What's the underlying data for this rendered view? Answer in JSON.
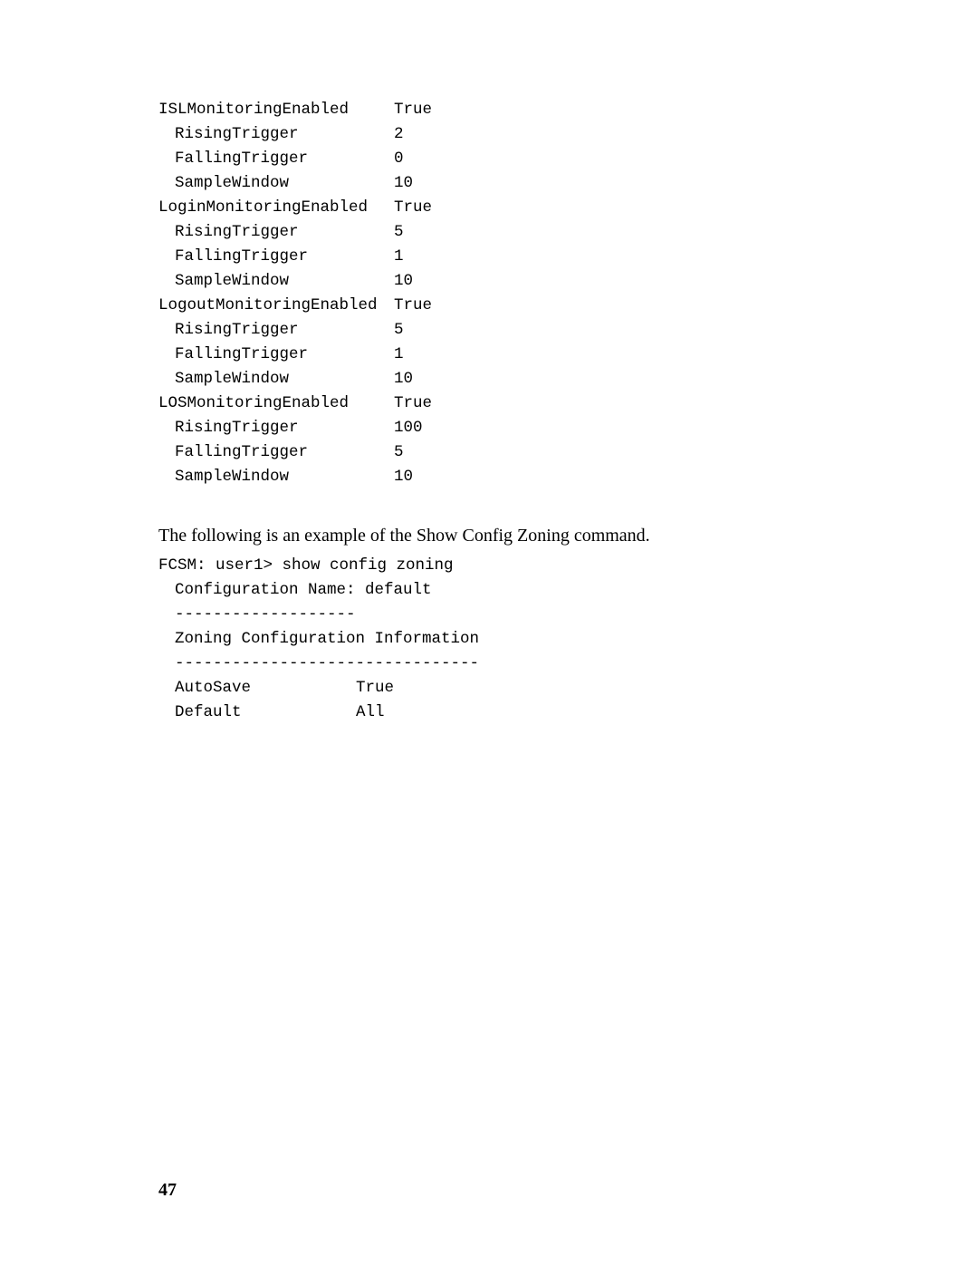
{
  "threshold_rows": [
    {
      "label": "ISLMonitoringEnabled",
      "value": "True",
      "indent": 0
    },
    {
      "label": "RisingTrigger",
      "value": "2",
      "indent": 1
    },
    {
      "label": "FallingTrigger",
      "value": "0",
      "indent": 1
    },
    {
      "label": "SampleWindow",
      "value": "10",
      "indent": 1
    },
    {
      "label": "LoginMonitoringEnabled",
      "value": "True",
      "indent": 0
    },
    {
      "label": "RisingTrigger",
      "value": "5",
      "indent": 1
    },
    {
      "label": "FallingTrigger",
      "value": "1",
      "indent": 1
    },
    {
      "label": "SampleWindow",
      "value": "10",
      "indent": 1
    },
    {
      "label": "LogoutMonitoringEnabled",
      "value": "True",
      "indent": 0
    },
    {
      "label": "RisingTrigger",
      "value": "5",
      "indent": 1
    },
    {
      "label": "FallingTrigger",
      "value": "1",
      "indent": 1
    },
    {
      "label": "SampleWindow",
      "value": "10",
      "indent": 1
    },
    {
      "label": "LOSMonitoringEnabled",
      "value": "True",
      "indent": 0
    },
    {
      "label": "RisingTrigger",
      "value": "100",
      "indent": 1
    },
    {
      "label": "FallingTrigger",
      "value": "5",
      "indent": 1
    },
    {
      "label": "SampleWindow",
      "value": "10",
      "indent": 1
    }
  ],
  "intro_text": "The following is an example of the Show Config Zoning command.",
  "zoning_lines": {
    "l1": "FCSM: user1> show config zoning",
    "l2": "Configuration Name: default",
    "l3": "-------------------",
    "l4": "Zoning Configuration Information",
    "l5": "--------------------------------"
  },
  "zoning_rows": [
    {
      "label": "AutoSave",
      "value": "True"
    },
    {
      "label": "Default",
      "value": "All"
    }
  ],
  "page_number": "47"
}
